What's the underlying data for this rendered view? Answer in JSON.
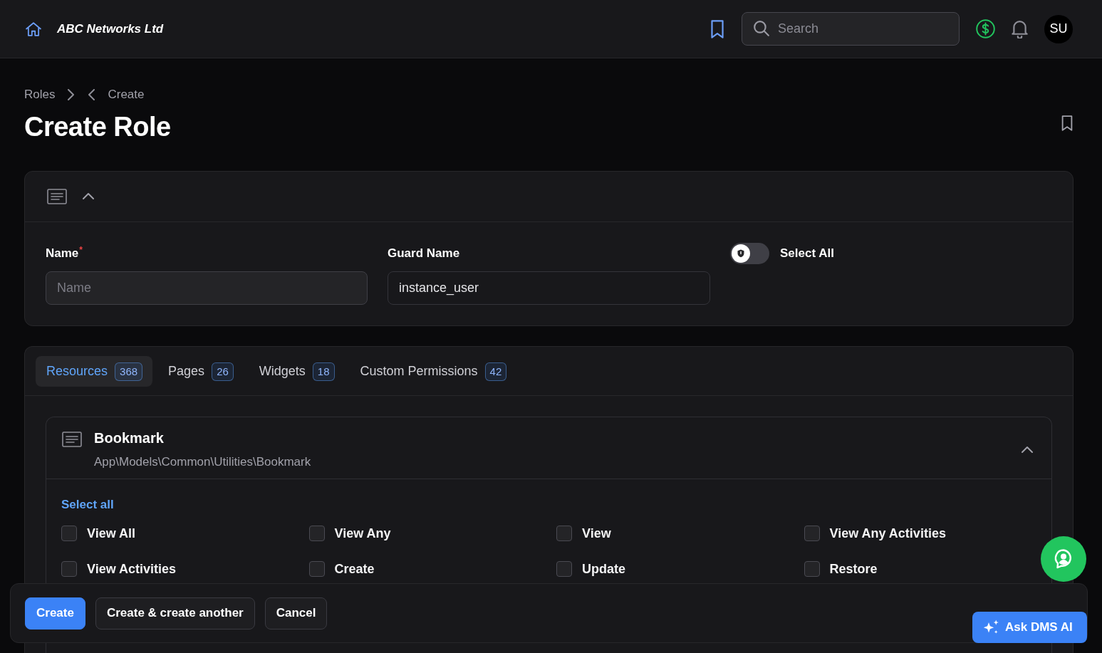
{
  "topbar": {
    "brand": "ABC Networks Ltd",
    "search": {
      "placeholder": "Search"
    },
    "avatar": "SU"
  },
  "breadcrumbs": [
    {
      "label": "Roles"
    },
    {
      "label": "Create"
    }
  ],
  "page": {
    "title": "Create Role"
  },
  "role_form": {
    "expanded": true,
    "fields": [
      {
        "label": "Name",
        "required_mark": "*",
        "placeholder": "Name",
        "disabled": false
      },
      {
        "label": "Guard Name",
        "value": "instance_user",
        "disabled": true
      }
    ],
    "select_all_toggle": {
      "label": "Select All",
      "on": false
    }
  },
  "permissions": {
    "tabs": [
      {
        "label": "Resources",
        "count": "368",
        "selected": true
      },
      {
        "label": "Pages",
        "count": "26",
        "selected": false
      },
      {
        "label": "Widgets",
        "count": "18",
        "selected": false
      },
      {
        "label": "Custom Permissions",
        "count": "42",
        "selected": false
      }
    ],
    "resources": [
      {
        "title": "Bookmark",
        "subtitle": "App\\Models\\Common\\Utilities\\Bookmark",
        "expanded": true,
        "select_all": "Select all",
        "items": [
          {
            "label": "View All",
            "checked": false
          },
          {
            "label": "View Any",
            "checked": false
          },
          {
            "label": "View",
            "checked": false
          },
          {
            "label": "View Any Activities",
            "checked": false
          },
          {
            "label": "View Activities",
            "checked": false
          },
          {
            "label": "Create",
            "checked": false
          },
          {
            "label": "Update",
            "checked": false
          },
          {
            "label": "Restore",
            "checked": false
          }
        ]
      }
    ]
  },
  "actions": [
    {
      "label": "Create",
      "kind": "primary"
    },
    {
      "label": "Create & create another",
      "kind": "secondary"
    },
    {
      "label": "Cancel",
      "kind": "secondary"
    }
  ],
  "assistant": {
    "label": "Ask DMS AI"
  }
}
